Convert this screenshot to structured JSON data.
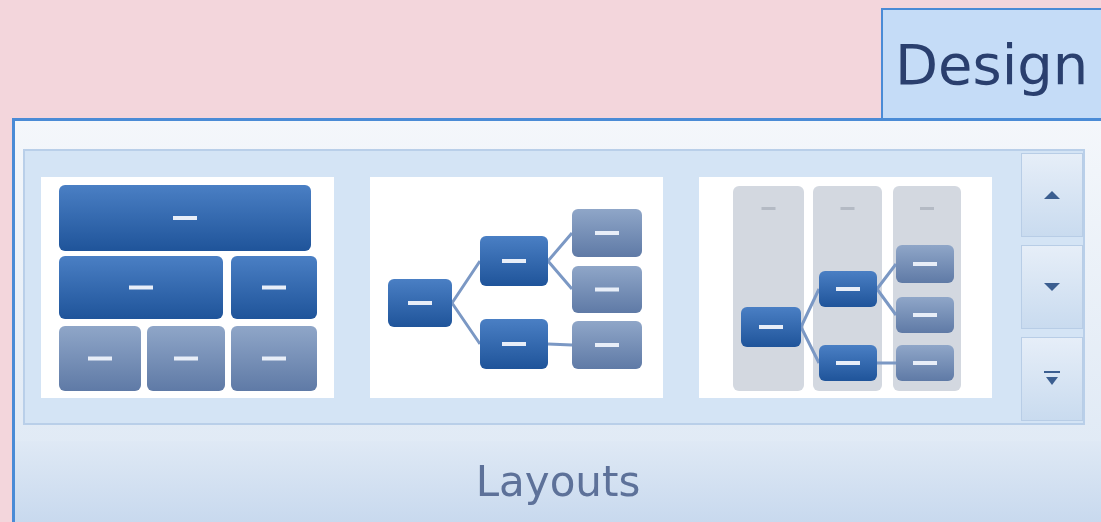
{
  "tabs": [
    {
      "label": "Design",
      "selected": true
    }
  ],
  "group": {
    "label": "Layouts",
    "gallery": [
      {
        "kind": "block-hierarchy"
      },
      {
        "kind": "horizontal-tree"
      },
      {
        "kind": "column-hierarchy"
      }
    ]
  }
}
